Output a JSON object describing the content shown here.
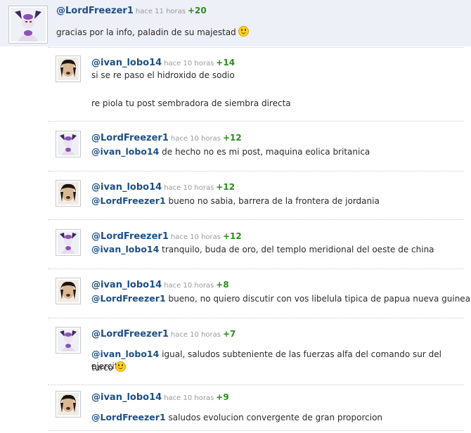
{
  "comments": [
    {
      "user": "@LordFreezer1",
      "time": "hace 11 horas",
      "votes": "+20",
      "text": "gracias por la info, paladin de su majestad",
      "avatar": "frieza-avatar",
      "smiley": true
    },
    {
      "user": "@ivan_lobo14",
      "time": "hace 10 horas",
      "votes": "+14",
      "line1": "si se re paso el hidroxido de sodio",
      "line2": "re piola tu post sembradora de siembra directa",
      "avatar": "ivan-avatar"
    },
    {
      "user": "@LordFreezer1",
      "time": "hace 10 horas",
      "votes": "+12",
      "mention": "@ivan_lobo14",
      "text": "de hecho no es mi post, maquina eolica britanica",
      "avatar": "frieza-avatar"
    },
    {
      "user": "@ivan_lobo14",
      "time": "hace 10 horas",
      "votes": "+12",
      "mention": "@LordFreezer1",
      "text": "bueno no sabia, barrera de la frontera de jordania",
      "avatar": "ivan-avatar"
    },
    {
      "user": "@LordFreezer1",
      "time": "hace 10 horas",
      "votes": "+12",
      "mention": "@ivan_lobo14",
      "text": "tranquilo, buda de oro, del templo meridional del oeste de china",
      "avatar": "frieza-avatar"
    },
    {
      "user": "@ivan_lobo14",
      "time": "hace 10 horas",
      "votes": "+8",
      "mention": "@LordFreezer1",
      "text": "bueno, no quiero discutir con vos libelula tipica de papua nueva guinea",
      "avatar": "ivan-avatar"
    },
    {
      "user": "@LordFreezer1",
      "time": "hace 10 horas",
      "votes": "+7",
      "mention": "@ivan_lobo14",
      "text": "igual, saludos subteniente de las fuerzas alfa del comando sur del ejercito",
      "text2": "turco",
      "avatar": "frieza-avatar",
      "smiley": true
    },
    {
      "user": "@ivan_lobo14",
      "time": "hace 10 horas",
      "votes": "+9",
      "mention": "@LordFreezer1",
      "text": "saludos evolucion convergente de gran proporcion",
      "avatar": "ivan-avatar"
    }
  ]
}
